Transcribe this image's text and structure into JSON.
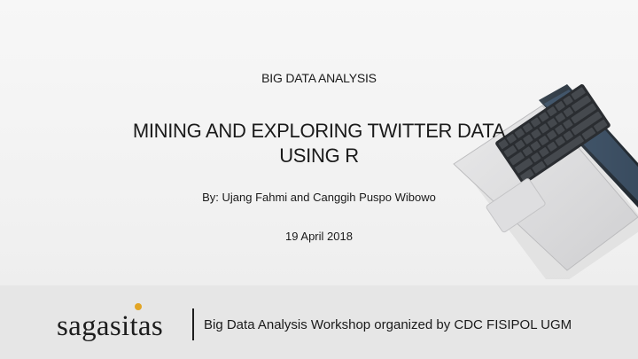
{
  "slide": {
    "subtitle": "BIG DATA ANALYSIS",
    "title_line1": "MINING AND EXPLORING TWITTER DATA",
    "title_line2": "USING R",
    "authors": "By: Ujang Fahmi and Canggih Puspo Wibowo",
    "date": "19 April 2018"
  },
  "footer": {
    "logo_text": "sagasitas",
    "caption": "Big Data Analysis Workshop organized by CDC FISIPOL UGM"
  },
  "colors": {
    "logo_accent": "#e2a526",
    "footer_bg": "#e6e6e6",
    "text": "#1a1a1a"
  }
}
